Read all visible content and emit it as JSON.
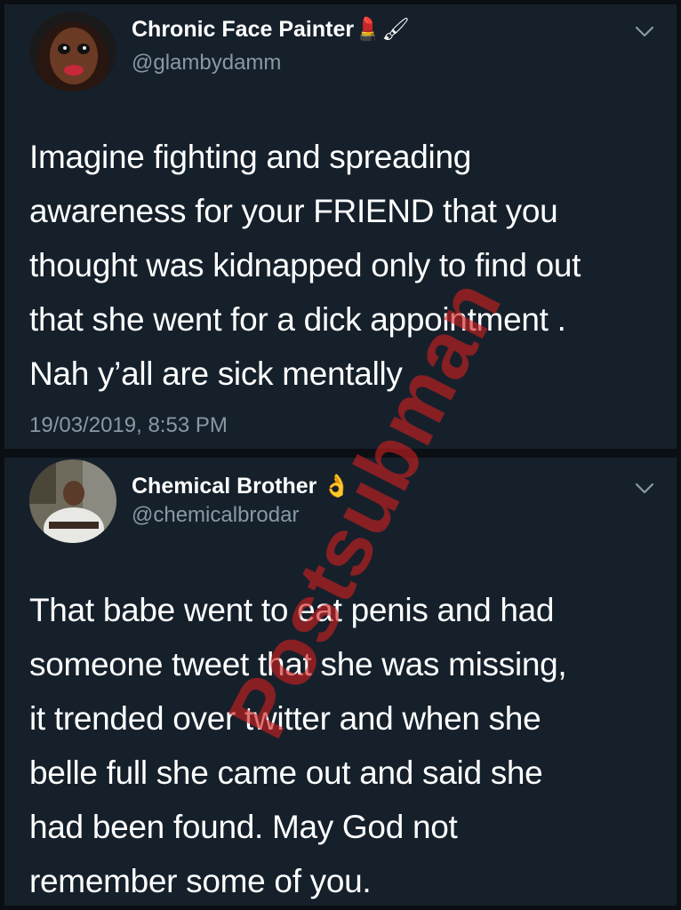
{
  "tweets": [
    {
      "display_name": "Chronic Face Painter",
      "name_emojis": "💄🖌",
      "handle": "@glambydamm",
      "text_lines": [
        "Imagine fighting and spreading",
        "awareness for your FRIEND that you",
        "thought was kidnapped only to find out",
        "that she went for a dick appointment .",
        "Nah y’all are sick mentally"
      ],
      "timestamp": "19/03/2019, 8:53 PM",
      "menu_icon": "chevron-down-icon"
    },
    {
      "display_name": "Chemical Brother",
      "name_emojis": "👌",
      "handle": "@chemicalbrodar",
      "text_lines": [
        "That babe went to eat penis and had",
        "someone tweet that she was missing,",
        "it trended over twitter and when she",
        "belle full she came out and said she",
        "had been found. May God not",
        "remember some of you."
      ],
      "menu_icon": "chevron-down-icon"
    }
  ],
  "watermark": "Postsubman",
  "colors": {
    "card_background": "#15202b",
    "outer_background": "#0b0f14",
    "primary_text": "#ffffff",
    "secondary_text": "#8899a6",
    "watermark": "#cd1e1e"
  }
}
